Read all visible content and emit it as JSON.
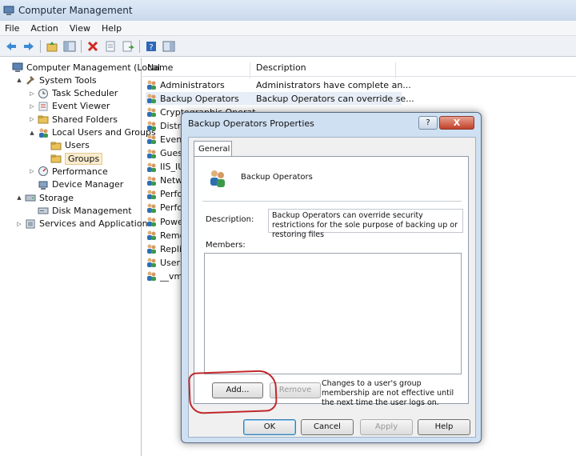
{
  "window": {
    "title": "Computer Management"
  },
  "menu": [
    "File",
    "Action",
    "View",
    "Help"
  ],
  "tree": [
    {
      "label": "Computer Management (Local",
      "indent": 0,
      "arrow": "",
      "icon": "computer-icon"
    },
    {
      "label": "System Tools",
      "indent": 1,
      "arrow": "▲",
      "icon": "tools-icon"
    },
    {
      "label": "Task Scheduler",
      "indent": 2,
      "arrow": "▷",
      "icon": "clock-icon"
    },
    {
      "label": "Event Viewer",
      "indent": 2,
      "arrow": "▷",
      "icon": "event-icon"
    },
    {
      "label": "Shared Folders",
      "indent": 2,
      "arrow": "▷",
      "icon": "folder-icon"
    },
    {
      "label": "Local Users and Groups",
      "indent": 2,
      "arrow": "▲",
      "icon": "users-icon"
    },
    {
      "label": "Users",
      "indent": 3,
      "arrow": "",
      "icon": "folder-icon"
    },
    {
      "label": "Groups",
      "indent": 3,
      "arrow": "",
      "icon": "folder-icon",
      "selected": true
    },
    {
      "label": "Performance",
      "indent": 2,
      "arrow": "▷",
      "icon": "performance-icon"
    },
    {
      "label": "Device Manager",
      "indent": 2,
      "arrow": "",
      "icon": "device-icon"
    },
    {
      "label": "Storage",
      "indent": 1,
      "arrow": "▲",
      "icon": "storage-icon"
    },
    {
      "label": "Disk Management",
      "indent": 2,
      "arrow": "",
      "icon": "disk-icon"
    },
    {
      "label": "Services and Applications",
      "indent": 1,
      "arrow": "▷",
      "icon": "services-icon"
    }
  ],
  "list": {
    "columns": [
      "Name",
      "Description"
    ],
    "rows": [
      {
        "name": "Administrators",
        "desc": "Administrators have complete an..."
      },
      {
        "name": "Backup Operators",
        "desc": "Backup Operators can override se...",
        "highlight": true
      },
      {
        "name": "Cryptographic Operat",
        "desc": ""
      },
      {
        "name": "Distri",
        "desc": ""
      },
      {
        "name": "Event",
        "desc": ""
      },
      {
        "name": "Guest",
        "desc": ""
      },
      {
        "name": "IIS_IU",
        "desc": ""
      },
      {
        "name": "Netw",
        "desc": ""
      },
      {
        "name": "Perfo",
        "desc": ""
      },
      {
        "name": "Perfo",
        "desc": ""
      },
      {
        "name": "Powe",
        "desc": ""
      },
      {
        "name": "Remo",
        "desc": ""
      },
      {
        "name": "Replic",
        "desc": ""
      },
      {
        "name": "Users",
        "desc": ""
      },
      {
        "name": "__vmw",
        "desc": ""
      }
    ]
  },
  "dialog": {
    "title": "Backup Operators Properties",
    "help": "?",
    "close": "X",
    "tab": "General",
    "group_name": "Backup Operators",
    "description_label": "Description:",
    "description": "Backup Operators can override security restrictions for the sole purpose of backing up or restoring files",
    "members_label": "Members:",
    "add": "Add...",
    "remove": "Remove",
    "note": "Changes to a user's group membership are not effective until the next time the user logs on.",
    "ok": "OK",
    "cancel": "Cancel",
    "apply": "Apply",
    "help_button": "Help"
  }
}
